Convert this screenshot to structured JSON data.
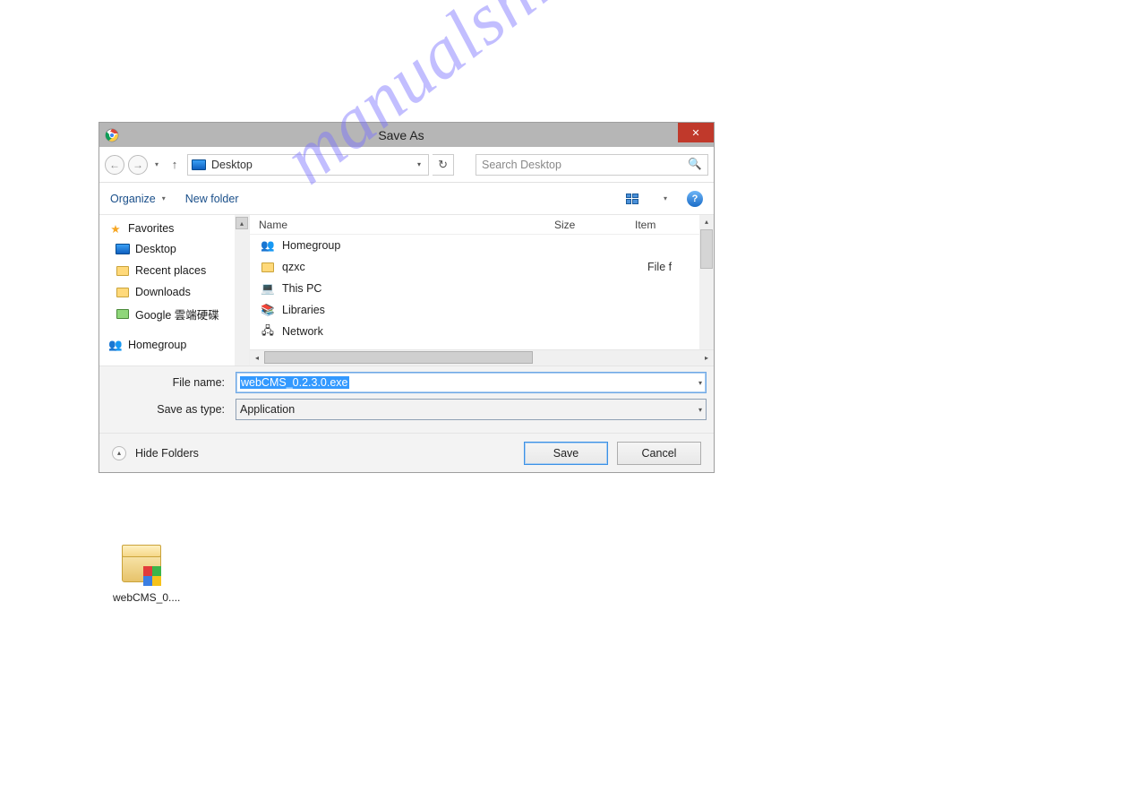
{
  "window": {
    "title": "Save As",
    "close_symbol": "✕"
  },
  "nav": {
    "location": "Desktop",
    "search_placeholder": "Search Desktop"
  },
  "toolbar": {
    "organize": "Organize",
    "new_folder": "New folder"
  },
  "sidebar": {
    "head1": "Favorites",
    "items1": [
      "Desktop",
      "Recent places",
      "Downloads",
      "Google 雲端硬碟"
    ],
    "head2": "Homegroup"
  },
  "columns": {
    "name": "Name",
    "size": "Size",
    "item": "Item"
  },
  "rows": [
    {
      "icon": "homegroup-icon",
      "name": "Homegroup",
      "item": ""
    },
    {
      "icon": "user-folder-icon",
      "name": "qzxc",
      "item": "File f"
    },
    {
      "icon": "pc-icon",
      "name": "This PC",
      "item": ""
    },
    {
      "icon": "libraries-icon",
      "name": "Libraries",
      "item": ""
    },
    {
      "icon": "network-icon",
      "name": "Network",
      "item": ""
    }
  ],
  "fields": {
    "file_name_label": "File name:",
    "file_name_value": "webCMS_0.2.3.0.exe",
    "save_type_label": "Save as type:",
    "save_type_value": "Application"
  },
  "footer": {
    "hide": "Hide Folders",
    "save": "Save",
    "cancel": "Cancel"
  },
  "shortcut": {
    "label": "webCMS_0...."
  },
  "watermark": "manualshive.com"
}
